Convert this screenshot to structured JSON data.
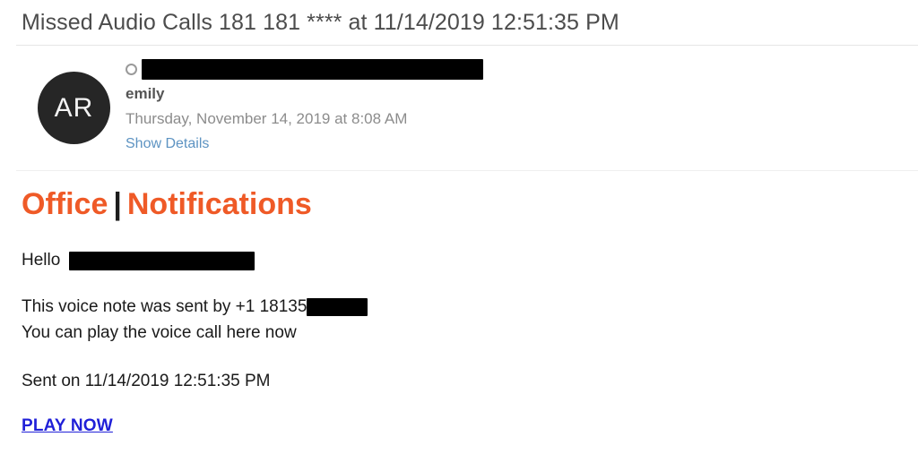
{
  "email": {
    "subject": "Missed Audio Calls 181 181 **** at 11/14/2019 12:51:35 PM",
    "sender": {
      "avatar_initials": "AR",
      "contact_icon": "contact-circle-icon",
      "address_redacted": true,
      "display_name": "emily",
      "date": "Thursday, November 14, 2019 at 8:08 AM",
      "show_details_label": "Show Details"
    },
    "body": {
      "brand": {
        "first": "Office",
        "separator": "|",
        "second": "Notifications",
        "accent_color": "#ef5a27",
        "separator_color": "#1d1d1d"
      },
      "greeting": "Hello",
      "greeting_name_redacted": true,
      "voice_note_line": "This voice note was sent by +1 18135",
      "voice_note_number_redacted": true,
      "play_line": "You can play the voice call here now",
      "sent_on": "Sent on 11/14/2019 12:51:35 PM",
      "play_now_label": "PLAY NOW",
      "play_now_color": "#2020d8"
    }
  }
}
